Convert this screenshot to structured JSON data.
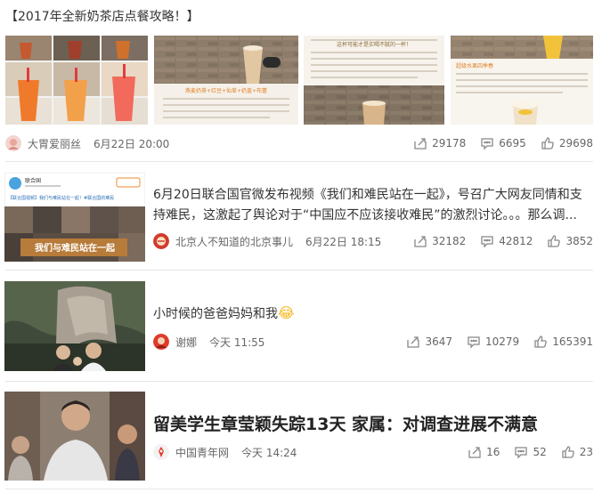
{
  "feed": {
    "items": [
      {
        "title": "【2017年全新奶茶店点餐攻略！】",
        "source": "大胃爱丽丝",
        "date": "6月22日 20:00",
        "share_count": "29178",
        "comment_count": "6695",
        "like_count": "29698",
        "thumbnail_texts": {
          "t2_caption": "燕麦奶茶+红豆+仙草+奶盖+布蕾",
          "t3_caption": "这杯可能才是实喝不腻的一杯！",
          "t4_caption": "超级水果四季春"
        }
      },
      {
        "text": "6月20日联合国官微发布视频《我们和难民站在一起》，号召广大网友同情和支持难民，这激起了舆论对于“中国应不应该接收难民”的激烈讨论。。。那么调...",
        "source": "北京人不知道的北京事儿",
        "date": "6月22日 18:15",
        "share_count": "32182",
        "comment_count": "42812",
        "like_count": "3852",
        "thumb_account": "联合国",
        "thumb_line": "【联合国视频】我们与难民站在一起！#联合国的难民",
        "thumb_banner": "我们与难民站在一起"
      },
      {
        "text": "小时候的爸爸妈妈和我",
        "emoji": "😂",
        "source": "谢娜",
        "date": "今天 11:55",
        "share_count": "3647",
        "comment_count": "10279",
        "like_count": "165391"
      },
      {
        "title": "留美学生章莹颖失踪13天 家属：对调查进展不满意",
        "source": "中国青年网",
        "date": "今天 14:24",
        "share_count": "16",
        "comment_count": "52",
        "like_count": "23"
      }
    ]
  },
  "icons": {
    "share": "share-icon",
    "comment": "comment-icon",
    "like": "like-icon"
  },
  "colors": {
    "text": "#333333",
    "meta": "#666666",
    "divider": "#e6e6e6",
    "icon": "#888888"
  }
}
